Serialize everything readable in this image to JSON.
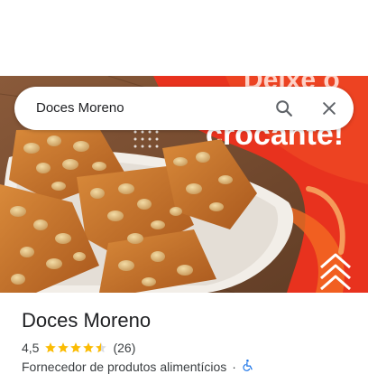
{
  "search": {
    "query": "Doces Moreno"
  },
  "hero": {
    "banner_text_line1": "Deixe o",
    "banner_text_line2": "crocante!",
    "colors": {
      "banner_red": "#e8321e",
      "banner_orange": "#f26a22"
    }
  },
  "place": {
    "name": "Doces Moreno",
    "rating": "4,5",
    "rating_value": 4.5,
    "reviews": "(26)",
    "category": "Fornecedor de produtos alimentícios",
    "separator": "·",
    "accessibility_icon": "wheelchair-icon"
  },
  "colors": {
    "star": "#fbbc04",
    "accessibility": "#1a73e8"
  }
}
